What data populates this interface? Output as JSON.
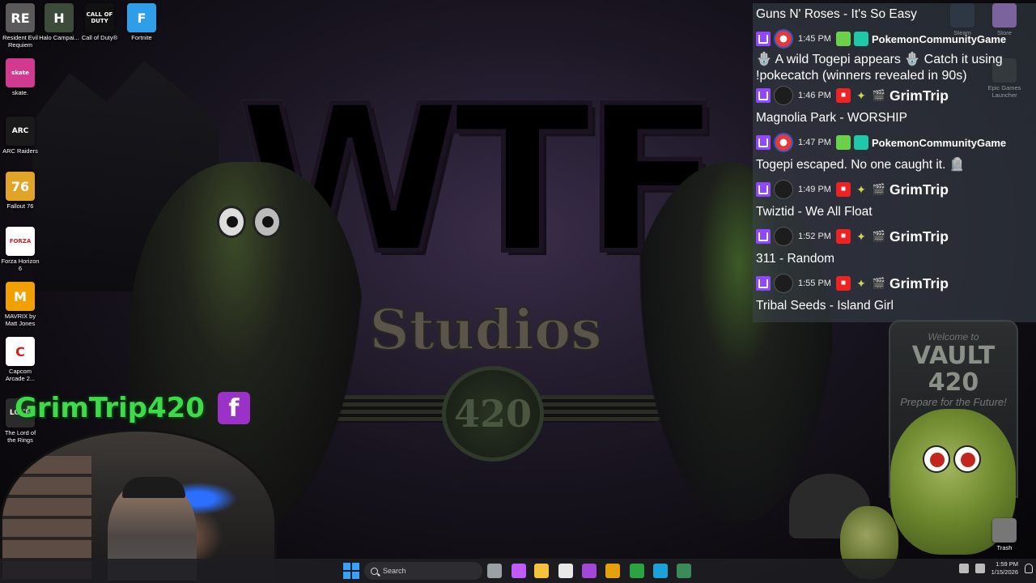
{
  "desktop_icons_left": [
    {
      "label": "Resident Evil Requiem",
      "icon": "resident-evil-icon",
      "color": "#5a5a5a",
      "glyph": "RE"
    },
    {
      "label": "Halo Campai...",
      "icon": "halo-icon",
      "color": "#3d4b3a",
      "glyph": "H"
    },
    {
      "label": "Call of Duty®",
      "icon": "call-of-duty-icon",
      "color": "#111111",
      "glyph": "CALL OF DUTY"
    },
    {
      "label": "Fortnite",
      "icon": "fortnite-icon",
      "color": "#2e9ee8",
      "glyph": "F"
    },
    {
      "label": "skate.",
      "icon": "skate-icon",
      "color": "#d23a8f",
      "glyph": "skate"
    },
    {
      "label": "ARC Raiders",
      "icon": "arc-raiders-icon",
      "color": "#1a1a1a",
      "glyph": "ARC"
    },
    {
      "label": "Fallout 76",
      "icon": "fallout-76-icon",
      "color": "#e0a526",
      "glyph": "76"
    },
    {
      "label": "Forza Horizon 6",
      "icon": "forza-horizon-icon",
      "color": "#ffffff",
      "glyph": "FORZA"
    },
    {
      "label": "MAVRIX by Matt Jones",
      "icon": "mavrix-icon",
      "color": "#f0a000",
      "glyph": "M"
    },
    {
      "label": "Capcom Arcade 2...",
      "icon": "capcom-arcade-icon",
      "color": "#ffffff",
      "glyph": "C"
    },
    {
      "label": "The Lord of the Rings",
      "icon": "lord-of-the-rings-icon",
      "color": "#2b2b2b",
      "glyph": "LOTR"
    }
  ],
  "desktop_icons_right": [
    {
      "label": "Steam",
      "icon": "steam-icon"
    },
    {
      "label": "Store",
      "icon": "store-icon"
    },
    {
      "label": "Epic Games Launcher",
      "icon": "epic-games-icon"
    },
    {
      "label": "Trash",
      "icon": "recycle-bin-icon"
    }
  ],
  "chat": {
    "entries": [
      {
        "type": "song",
        "text": "Guns N' Roses - It's So Easy"
      },
      {
        "type": "head",
        "time": "1:45 PM",
        "user": "PokemonCommunityGame",
        "avatar": "pokeball",
        "badges": [
          "leaf",
          "ctl"
        ],
        "user_style": "small"
      },
      {
        "type": "msg",
        "text": "🪬 A wild Togepi appears 🪬 Catch it using !pokecatch (winners revealed in 90s)"
      },
      {
        "type": "head",
        "time": "1:46 PM",
        "user": "GrimTrip",
        "avatar": "dark",
        "badges": [
          "cam",
          "star",
          "film"
        ],
        "user_style": "big"
      },
      {
        "type": "song",
        "text": "Magnolia Park - WORSHIP"
      },
      {
        "type": "head",
        "time": "1:47 PM",
        "user": "PokemonCommunityGame",
        "avatar": "pokeball",
        "badges": [
          "leaf",
          "ctl"
        ],
        "user_style": "small"
      },
      {
        "type": "song",
        "text": "Togepi escaped. No one caught it. 🪦"
      },
      {
        "type": "head",
        "time": "1:49 PM",
        "user": "GrimTrip",
        "avatar": "dark",
        "badges": [
          "cam",
          "star",
          "film"
        ],
        "user_style": "big"
      },
      {
        "type": "song",
        "text": "Twiztid - We All Float"
      },
      {
        "type": "head",
        "time": "1:52 PM",
        "user": "GrimTrip",
        "avatar": "dark",
        "badges": [
          "cam",
          "star",
          "film"
        ],
        "user_style": "big"
      },
      {
        "type": "song",
        "text": "311 - Random"
      },
      {
        "type": "head",
        "time": "1:55 PM",
        "user": "GrimTrip",
        "avatar": "dark",
        "badges": [
          "cam",
          "star",
          "film"
        ],
        "user_style": "big"
      },
      {
        "type": "song",
        "text": "Tribal Seeds - Island Girl"
      }
    ]
  },
  "wallpaper": {
    "logo": "WTF",
    "studios": "Studios",
    "badge": "420",
    "vault_welcome": "Welcome to",
    "vault_name": "VAULT 420",
    "vault_tagline": "Prepare for the Future!"
  },
  "stream_overlay": {
    "handle": "GrimTrip420",
    "social": "f",
    "brand_color": "#3fd94c"
  },
  "taskbar": {
    "search_placeholder": "Search",
    "clock_time": "1:59 PM",
    "clock_date": "1/15/2026",
    "apps": [
      {
        "icon": "task-view-icon",
        "color": "#9aa0a6"
      },
      {
        "icon": "copilot-icon",
        "color": "#c25bff"
      },
      {
        "icon": "file-explorer-icon",
        "color": "#f4c23c"
      },
      {
        "icon": "microsoft-store-icon",
        "color": "#e8e8e8"
      },
      {
        "icon": "mail-icon",
        "color": "#a646d9"
      },
      {
        "icon": "plex-icon",
        "color": "#e5a00d"
      },
      {
        "icon": "xbox-icon",
        "color": "#2ca243"
      },
      {
        "icon": "edge-icon",
        "color": "#1aa3d9"
      },
      {
        "icon": "terminal-icon",
        "color": "#3a8a5a"
      }
    ]
  }
}
